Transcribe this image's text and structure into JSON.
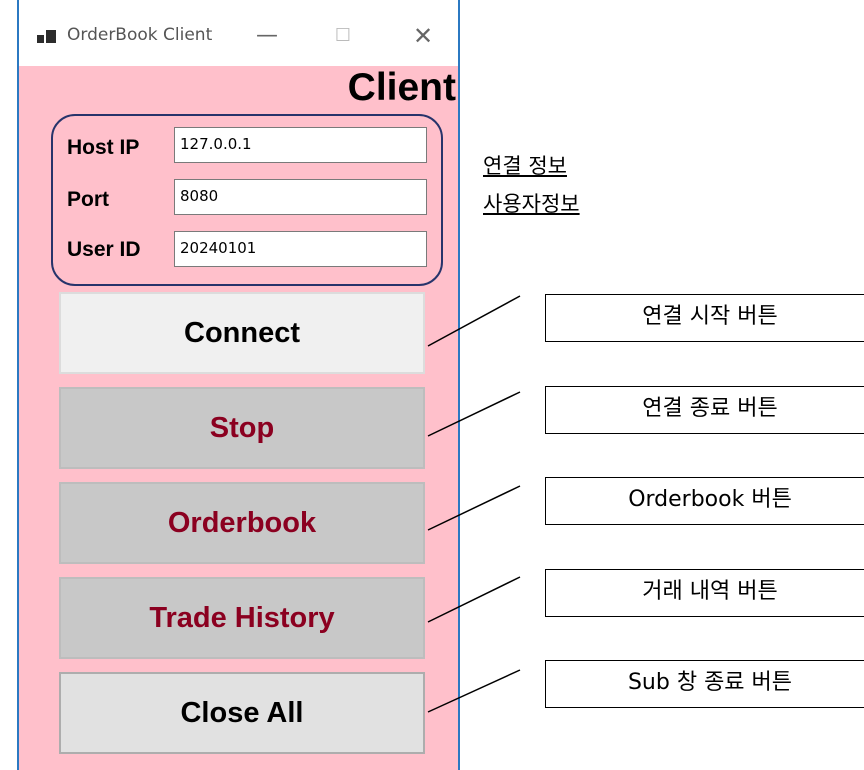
{
  "window": {
    "title": "OrderBook Client",
    "controls": {
      "minimize": "—",
      "maximize": "☐",
      "close": "✕"
    }
  },
  "header": {
    "title": "Client"
  },
  "connection": {
    "host_ip_label": "Host IP",
    "host_ip_value": "127.0.0.1",
    "port_label": "Port",
    "port_value": "8080",
    "user_id_label": "User ID",
    "user_id_value": "20240101"
  },
  "buttons": {
    "connect": "Connect",
    "stop": "Stop",
    "orderbook": "Orderbook",
    "trade_history": "Trade History",
    "close_all": "Close All"
  },
  "annotations": {
    "info_line1": "연결 정보 ",
    "info_line2": "사용자정보",
    "connect_desc": "연결 시작 버튼",
    "stop_desc": "연결 종료 버튼",
    "orderbook_desc": "Orderbook 버튼",
    "trade_history_desc": "거래 내역 버튼",
    "close_all_desc": "Sub 창 종료 버튼"
  },
  "colors": {
    "window_bg": "#ffc0cb",
    "window_border": "#2b79c2",
    "button_text_dark_red": "#8b0020",
    "group_border": "#27346b"
  }
}
